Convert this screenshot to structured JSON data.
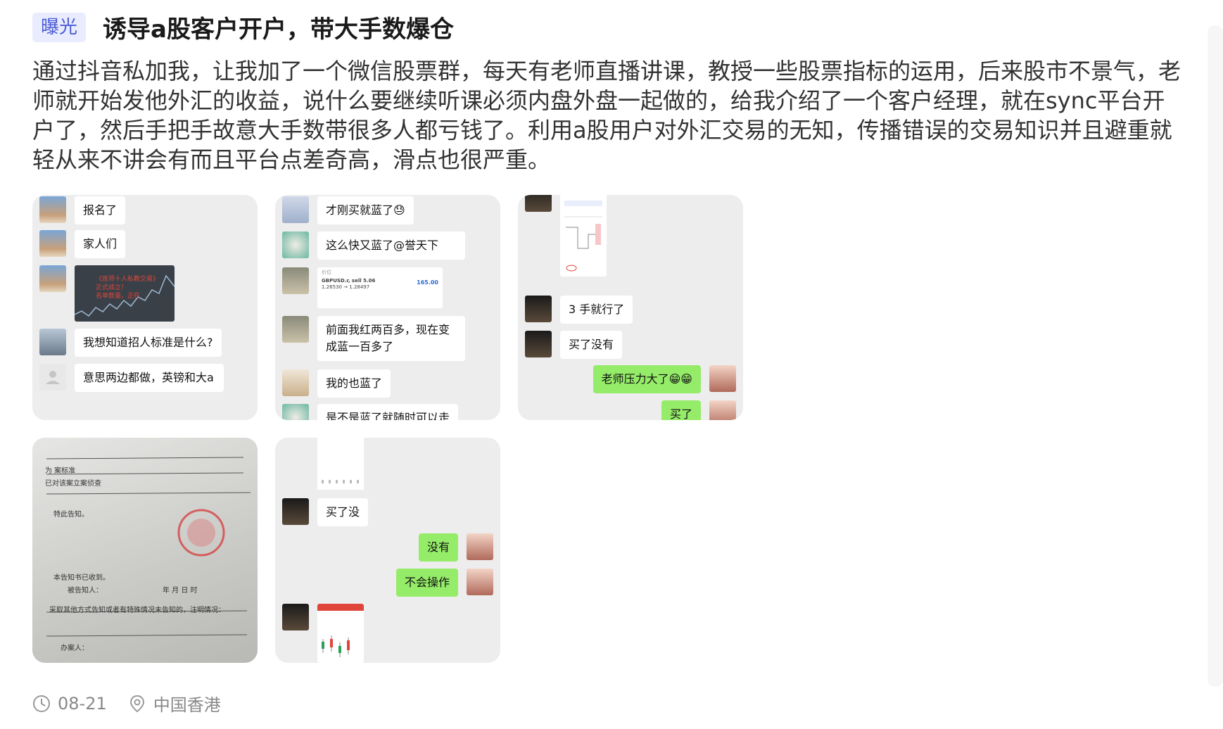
{
  "post": {
    "tag": "曝光",
    "title": "诱导a股客户开户，带大手数爆仓",
    "content": "通过抖音私加我，让我加了一个微信股票群，每天有老师直播讲课，教授一些股票指标的运用，后来股市不景气，老师就开始发他外汇的收益，说什么要继续听课必须内盘外盘一起做的，给我介绍了一个客户经理，就在sync平台开户了，然后手把手故意大手数带很多人都亏钱了。利用a股用户对外汇交易的无知，传播错误的交易知识并且避重就轻从来不讲会有而且平台点差奇高，滑点也很严重。"
  },
  "images": {
    "card1": {
      "msg1": "报名了",
      "msg2": "家人们",
      "img_text1": "《炼师十人私教交易》",
      "img_text2": "正式成立！",
      "img_text3": "名单数量，正在",
      "msg3": "我想知道招人标准是什么?",
      "msg4": "意思两边都做，英镑和大a"
    },
    "card2": {
      "msg1": "才刚买就蓝了😓",
      "msg2": "这么快又蓝了@誉天下",
      "trade_label": "价位",
      "trade_symbol": "GBPUSD.r, sell 5.06",
      "trade_prices": "1.26530 → 1.28497",
      "trade_value": "165.00",
      "msg3": "前面我红两百多，现在变成蓝一百多了",
      "msg4": "我的也蓝了",
      "msg5": "是不是蓝了就随时可以走"
    },
    "card3": {
      "msg1": "3 手就行了",
      "msg2": "买了没有",
      "msg3": "老师压力大了😁😁",
      "msg4": "买了"
    },
    "card4": {
      "line1": "为         案标准",
      "line2": "已对该案立案侦查",
      "line3": "特此告知。",
      "line4": "本告知书已收到。",
      "line5": "被告知人：",
      "line6": "年   月   日   时",
      "line7": "采取其他方式告知或者有特殊情况未告知的，注明情况：",
      "line8": "办案人："
    },
    "card5": {
      "msg1": "买了没",
      "msg2": "没有",
      "msg3": "不会操作"
    }
  },
  "footer": {
    "date": "08-21",
    "location": "中国香港"
  },
  "colors": {
    "tag_bg": "#e9ecff",
    "tag_text": "#4a5bd6",
    "bubble_green": "#95ec69",
    "card_bg": "#ededed"
  }
}
